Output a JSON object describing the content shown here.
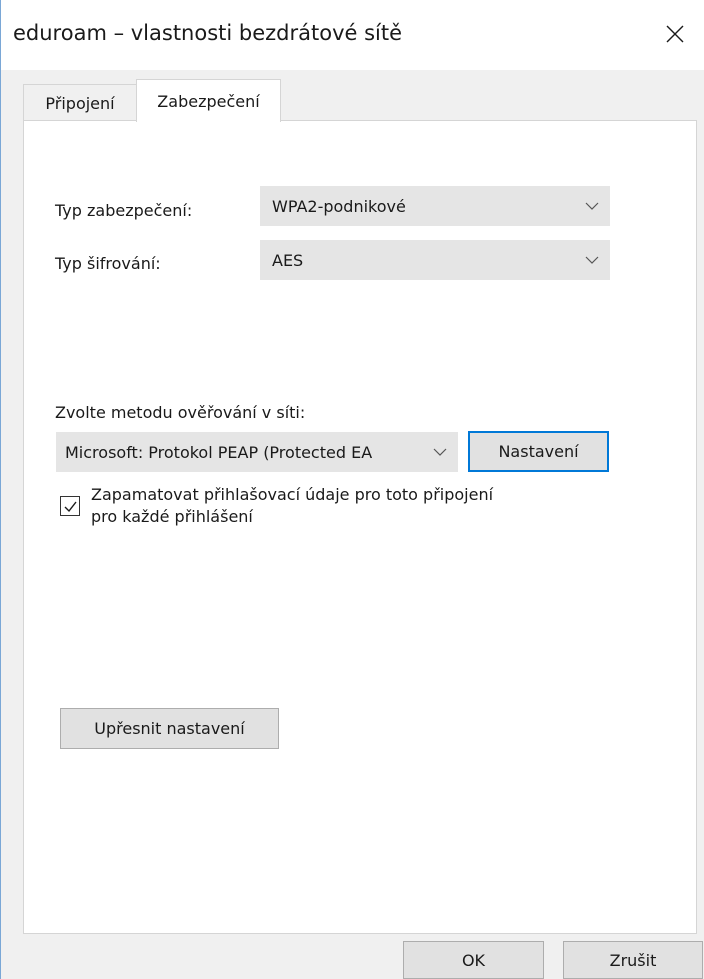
{
  "window": {
    "title": "eduroam – vlastnosti bezdrátové sítě"
  },
  "tabs": [
    {
      "label": "Připojení",
      "active": false
    },
    {
      "label": "Zabezpečení",
      "active": true
    }
  ],
  "security": {
    "security_type_label": "Typ zabezpečení:",
    "security_type_value": "WPA2-podnikové",
    "encryption_type_label": "Typ šifrování:",
    "encryption_type_value": "AES",
    "auth_method_label": "Zvolte metodu ověřování v síti:",
    "auth_method_value": "Microsoft: Protokol PEAP (Protected EA",
    "settings_button": "Nastavení",
    "remember_checkbox": {
      "checked": true,
      "line1": "Zapamatovat přihlašovací údaje pro toto připojení",
      "line2": "pro každé přihlášení"
    },
    "advanced_button": "Upřesnit nastavení"
  },
  "footer": {
    "ok_label": "OK",
    "cancel_label": "Zrušit"
  },
  "icons": {
    "close": "close-icon",
    "dropdown": "chevron-down-icon",
    "check": "checkmark-icon"
  },
  "colors": {
    "accent": "#0078d7",
    "button_bg": "#e1e1e1",
    "combo_bg": "#e5e5e5"
  }
}
